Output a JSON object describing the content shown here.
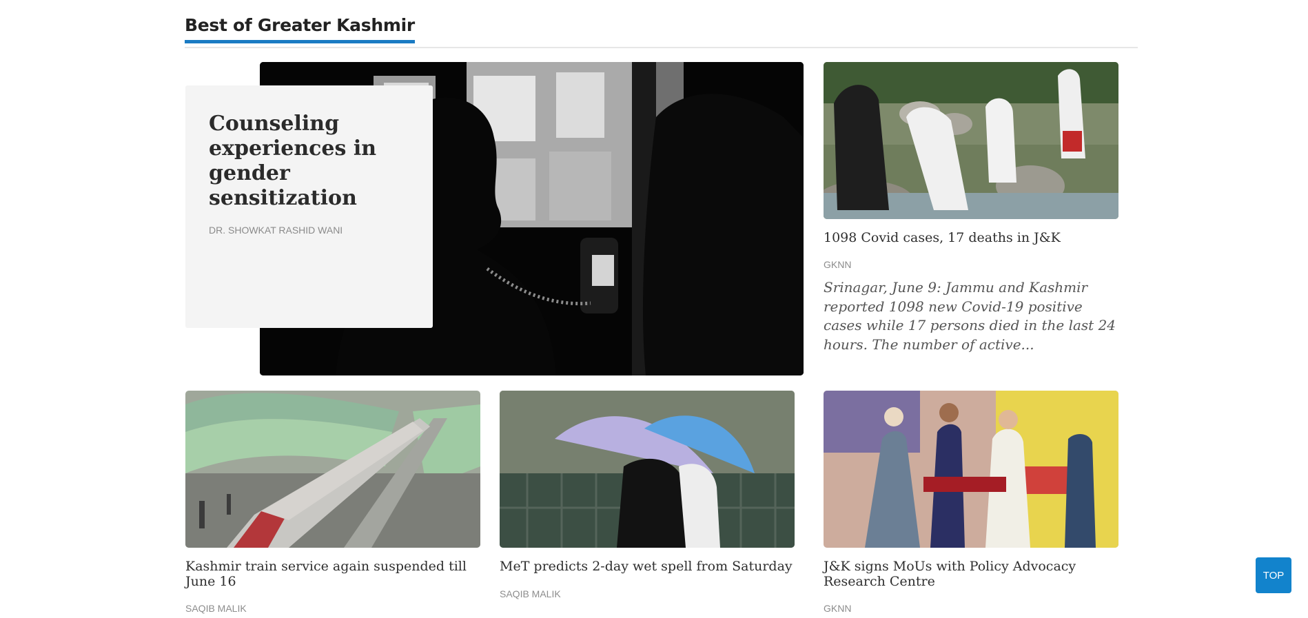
{
  "section": {
    "title": "Best of Greater Kashmir"
  },
  "featured": {
    "title": "Counseling experiences in gender sensitization",
    "author": "DR. SHOWKAT RASHID WANI"
  },
  "side_story": {
    "title": "1098 Covid cases, 17 deaths in J&K",
    "author": "GKNN",
    "excerpt": "Srinagar, June 9: Jammu and Kashmir reported 1098 new Covid-19 positive cases while 17 persons died in the last 24 hours. The number of active..."
  },
  "stories": [
    {
      "title": "Kashmir train service again suspended till June 16",
      "author": "SAQIB MALIK"
    },
    {
      "title": "MeT predicts 2-day wet spell from Saturday",
      "author": "SAQIB MALIK"
    },
    {
      "title": "J&K signs MoUs with Policy Advocacy Research Centre",
      "author": "GKNN"
    }
  ],
  "top_button": {
    "label": "TOP"
  }
}
